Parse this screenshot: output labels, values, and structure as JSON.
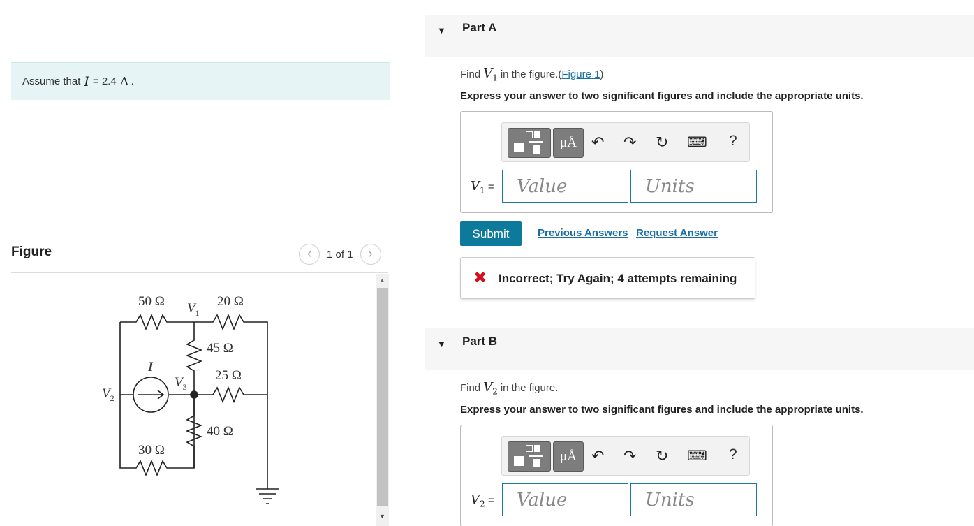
{
  "problem": {
    "assume_prefix": "Assume that",
    "assume_var": "I",
    "assume_eq": "= 2.4",
    "assume_unit": "A",
    "assume_end": "."
  },
  "figure": {
    "title": "Figure",
    "pager_text": "1 of 1",
    "labels": {
      "r1": "50 Ω",
      "r2": "20 Ω",
      "r3": "45 Ω",
      "r4": "25 Ω",
      "r5": "40 Ω",
      "r6": "30 Ω",
      "v1": "V",
      "v1_sub": "1",
      "v2": "V",
      "v2_sub": "2",
      "v3": "V",
      "v3_sub": "3",
      "i": "I"
    }
  },
  "parts": [
    {
      "title": "Part A",
      "find_prefix": "Find",
      "find_var": "V",
      "find_sub": "1",
      "find_suffix": "in the figure.",
      "figure_link": "Figure 1",
      "express": "Express your answer to two significant figures and include the appropriate units.",
      "toolbar_units_label": "μÅ",
      "answer_label_var": "V",
      "answer_label_sub": "1",
      "answer_label_eq": "=",
      "value_placeholder": "Value",
      "units_placeholder": "Units",
      "submit": "Submit",
      "previous_answers": "Previous Answers",
      "request_answer": "Request Answer",
      "feedback": "Incorrect; Try Again; 4 attempts remaining"
    },
    {
      "title": "Part B",
      "find_prefix": "Find",
      "find_var": "V",
      "find_sub": "2",
      "find_suffix": "in the figure.",
      "express": "Express your answer to two significant figures and include the appropriate units.",
      "toolbar_units_label": "μÅ",
      "answer_label_var": "V",
      "answer_label_sub": "2",
      "answer_label_eq": "=",
      "value_placeholder": "Value",
      "units_placeholder": "Units"
    }
  ],
  "toolbar_icons": [
    "templates-icon",
    "units-icon",
    "undo-icon",
    "redo-icon",
    "reset-icon",
    "keyboard-icon",
    "help-icon"
  ],
  "toolbar_help": "?",
  "colors": {
    "accent": "#0d7a9c",
    "link": "#1a6fa3",
    "error": "#d0101a",
    "assume_bg": "#e6f4f5"
  }
}
